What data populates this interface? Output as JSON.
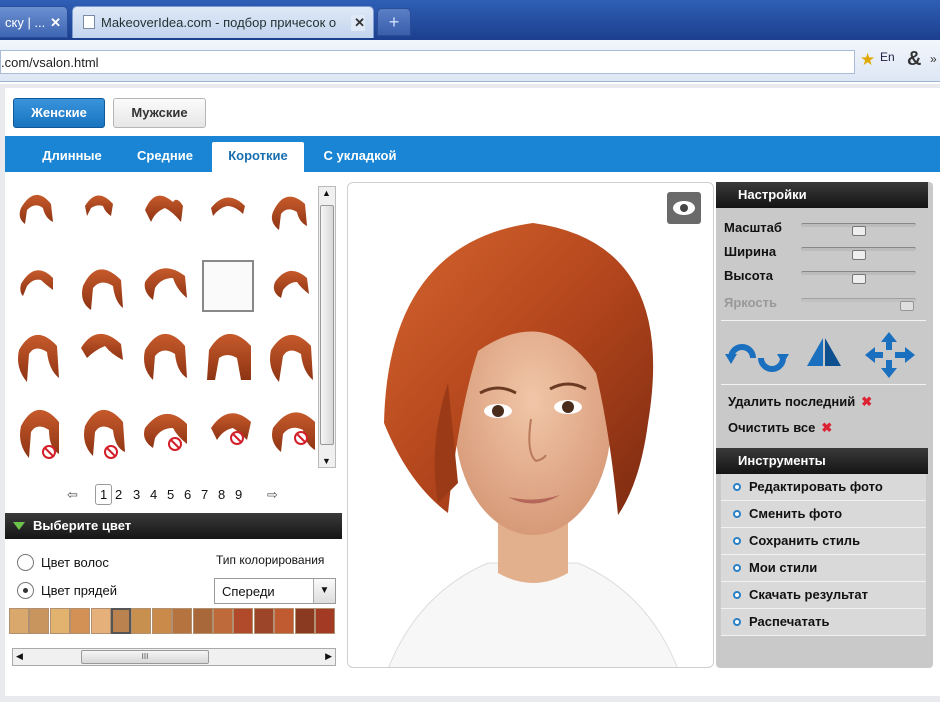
{
  "browser": {
    "tabs": [
      {
        "title": "ску | ...",
        "close": "✕"
      },
      {
        "title": "MakeoverIdea.com - подбор причесок о",
        "close": "✕"
      }
    ],
    "new_tab": "+",
    "url": ".com/vsalon.html",
    "icons": [
      "star-icon",
      "translate-icon",
      "ampersand-icon"
    ],
    "translate_label": "En",
    "ampersand": "&"
  },
  "gender_buttons": {
    "women": "Женские",
    "men": "Мужские"
  },
  "categories": [
    "Длинные",
    "Средние",
    "Короткие",
    "С укладкой"
  ],
  "selected_category": "Короткие",
  "pager": {
    "prev": "⇦",
    "next": "⇨",
    "pages": [
      "1",
      "2",
      "3",
      "4",
      "5",
      "6",
      "7",
      "8",
      "9"
    ],
    "current": "1"
  },
  "color_panel": {
    "title": "Выберите цвет",
    "option_hair": "Цвет волос",
    "option_strands": "Цвет прядей",
    "coloring_type_label": "Тип колорирования",
    "coloring_type_value": "Спереди",
    "selected_option": "strands"
  },
  "swatch_colors": [
    "#d9a86c",
    "#c8955e",
    "#e2b36f",
    "#d49156",
    "#e6b07a",
    "#b9824f",
    "#c8904e",
    "#c98a4a",
    "#b57340",
    "#a9683a",
    "#bf6a3a",
    "#b04a2a",
    "#9d4528",
    "#c05a30",
    "#8b3a22",
    "#a33b24"
  ],
  "settings": {
    "title": "Настройки",
    "sliders": [
      {
        "label": "Масштаб",
        "value": 0.5
      },
      {
        "label": "Ширина",
        "value": 0.5
      },
      {
        "label": "Высота",
        "value": 0.5
      },
      {
        "label": "Яркость",
        "value": 0.98,
        "disabled": true
      }
    ],
    "delete_last": "Удалить последний",
    "clear_all": "Очистить все",
    "remove_mark": "✖"
  },
  "tools": {
    "title": "Инструменты",
    "items": [
      "Редактировать фото",
      "Сменить фото",
      "Сохранить стиль",
      "Мои стили",
      "Скачать результат",
      "Распечатать"
    ]
  },
  "scrollbar_grip": "III",
  "scroll_arrows": {
    "up": "▲",
    "down": "▼",
    "left": "◀",
    "right": "▶"
  }
}
